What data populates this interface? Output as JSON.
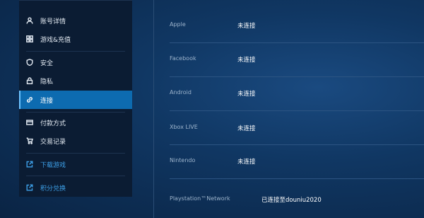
{
  "sidebar": {
    "items": [
      {
        "label": "账号详情",
        "icon": "user-icon"
      },
      {
        "label": "游戏&充值",
        "icon": "grid-icon"
      },
      {
        "label": "安全",
        "icon": "shield-icon"
      },
      {
        "label": "隐私",
        "icon": "lock-icon"
      },
      {
        "label": "连接",
        "icon": "link-icon",
        "active": true
      },
      {
        "label": "付款方式",
        "icon": "card-icon"
      },
      {
        "label": "交易记录",
        "icon": "cart-icon"
      },
      {
        "label": "下载游戏",
        "icon": "external-link-icon"
      },
      {
        "label": "积分兑换",
        "icon": "external-link-icon"
      }
    ]
  },
  "connections": [
    {
      "platform": "Apple",
      "status": "未连接"
    },
    {
      "platform": "Facebook",
      "status": "未连接"
    },
    {
      "platform": "Android",
      "status": "未连接"
    },
    {
      "platform": "Xbox LIVE",
      "status": "未连接"
    },
    {
      "platform": "Nintendo",
      "status": "未连接"
    },
    {
      "platform": "Playstation™Network",
      "status": "已连接至douniu2020"
    }
  ],
  "colors": {
    "accent": "#0d6bb0",
    "link": "#3da0e8",
    "sidebar_bg": "#0b1c33"
  }
}
